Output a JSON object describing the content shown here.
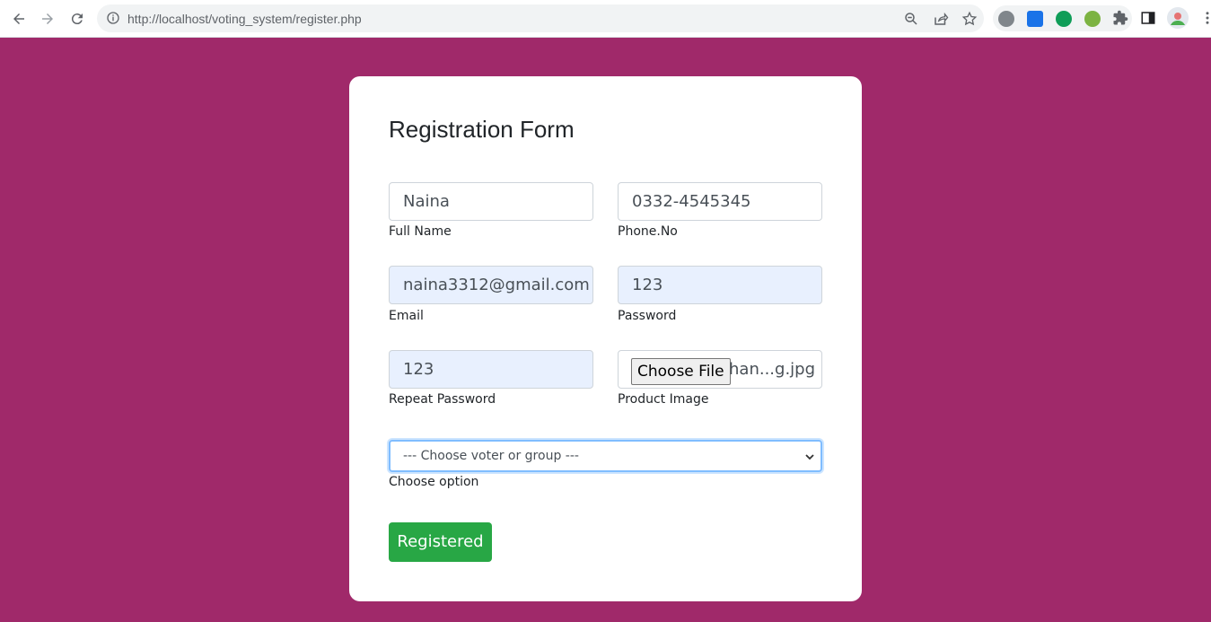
{
  "browser": {
    "url_host": "http://localhost",
    "url_path": "/voting_system/register.php"
  },
  "form": {
    "title": "Registration Form",
    "full_name": {
      "value": "Naina",
      "label": "Full Name"
    },
    "phone": {
      "value": "0332-4545345",
      "label": "Phone.No"
    },
    "email": {
      "value": "naina3312@gmail.com",
      "label": "Email"
    },
    "password": {
      "value": "123",
      "label": "Password"
    },
    "repeat_password": {
      "value": "123",
      "label": "Repeat Password"
    },
    "image": {
      "button_label": "Choose File",
      "file_name": "han...g.jpg",
      "label": "Product Image"
    },
    "choose": {
      "selected": "--- Choose voter or group ---",
      "label": "Choose option"
    },
    "submit_label": "Registered"
  },
  "colors": {
    "page_background": "#a0296a",
    "submit_button": "#28a745",
    "autofill_background": "#e8f0fe"
  },
  "icons": [
    "back-arrow-icon",
    "forward-arrow-icon",
    "reload-icon",
    "info-icon",
    "zoom-icon",
    "share-icon",
    "star-icon",
    "extensions-icon",
    "side-panel-icon",
    "menu-icon"
  ]
}
